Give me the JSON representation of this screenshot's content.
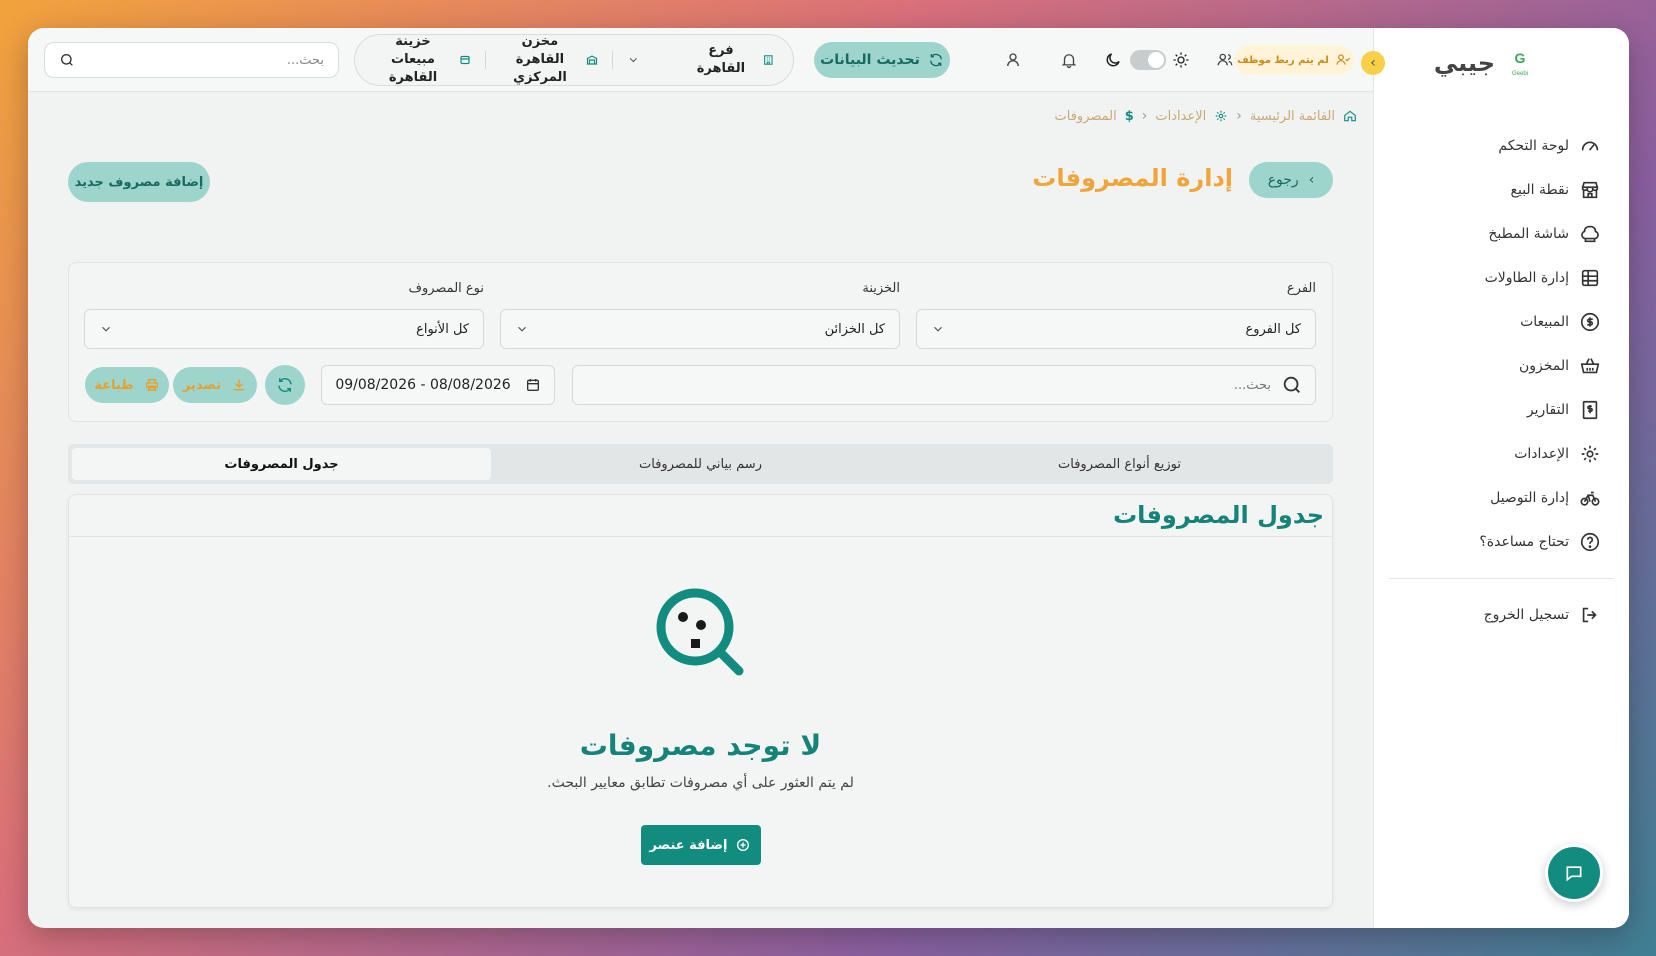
{
  "brand": {
    "name": "جيبي",
    "logo_text": "Geebi"
  },
  "sidebar": {
    "items": [
      {
        "label": "لوحة التحكم",
        "icon": "gauge-icon"
      },
      {
        "label": "نقطة البيع",
        "icon": "store-icon"
      },
      {
        "label": "شاشة المطبخ",
        "icon": "chef-hat-icon"
      },
      {
        "label": "إدارة الطاولات",
        "icon": "table-grid-icon"
      },
      {
        "label": "المبيعات",
        "icon": "dollar-circle-icon"
      },
      {
        "label": "المخزون",
        "icon": "basket-icon"
      },
      {
        "label": "التقارير",
        "icon": "receipt-dollar-icon"
      },
      {
        "label": "الإعدادات",
        "icon": "gear-icon"
      },
      {
        "label": "إدارة التوصيل",
        "icon": "bike-icon"
      },
      {
        "label": "تحتاج مساعدة؟",
        "icon": "help-circle-icon"
      }
    ],
    "logout": {
      "label": "تسجيل الخروج",
      "icon": "logout-icon"
    }
  },
  "topbar": {
    "search_placeholder": "بحث...",
    "treasury": "خزينة مبيعات القاهرة",
    "warehouse": "مخزن القاهرة المركزي",
    "branch": "فرع القاهرة",
    "refresh_label": "تحديث البيانات",
    "employee_badge": "لم يتم ربط موظف"
  },
  "breadcrumb": {
    "home": "القائمة الرئيسية",
    "settings": "الإعدادات",
    "current": "المصروفات"
  },
  "page": {
    "back_label": "رجوع",
    "title": "إدارة المصروفات",
    "add_button": "إضافة مصروف جديد"
  },
  "filters": {
    "branch_label": "الفرع",
    "branch_value": "كل الفروع",
    "treasury_label": "الخزينة",
    "treasury_value": "كل الخزائن",
    "type_label": "نوع المصروف",
    "type_value": "كل الأنواع",
    "search_placeholder": "بحث...",
    "date_range": "09/08/2026 - 08/08/2026",
    "export_label": "تصدير",
    "print_label": "طباعة"
  },
  "tabs": [
    {
      "label": "توزيع أنواع المصروفات",
      "active": false
    },
    {
      "label": "رسم بياني للمصروفات",
      "active": false
    },
    {
      "label": "جدول المصروفات",
      "active": true
    }
  ],
  "table_card": {
    "title": "جدول المصروفات",
    "empty_title": "لا توجد مصروفات",
    "empty_desc": ".لم يتم العثور على أي مصروفات تطابق معايير البحث",
    "empty_button": "إضافة عنصر"
  },
  "colors": {
    "primary": "#138c80",
    "primary_light": "#9dd4cc",
    "accent": "#f0a53a",
    "title_teal": "#158377"
  }
}
